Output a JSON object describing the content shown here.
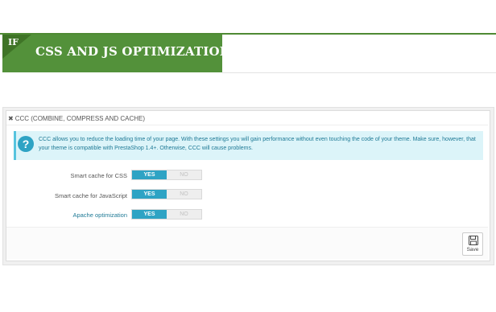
{
  "banner": {
    "badge": "IF",
    "title": "CSS AND JS OPTIMIZATION"
  },
  "panel": {
    "heading": "CCC (COMBINE, COMPRESS AND CACHE)",
    "heading_icon": "cogs-icon",
    "alert": {
      "icon": "question-circle-icon",
      "text_line1": "CCC allows you to reduce the loading time of your page. With these settings you will gain performance without even touching the code of your theme. Make sure, however, that",
      "text_line2": "your theme is compatible with PrestaShop 1.4+. Otherwise, CCC will cause problems."
    },
    "rows": [
      {
        "label": "Smart cache for CSS",
        "yes": "YES",
        "no": "NO",
        "value": "YES"
      },
      {
        "label": "Smart cache for JavaScript",
        "yes": "YES",
        "no": "NO",
        "value": "YES"
      },
      {
        "label": "Apache optimization",
        "yes": "YES",
        "no": "NO",
        "value": "YES"
      }
    ],
    "save_label": "Save",
    "save_icon": "floppy-disk-icon"
  },
  "colors": {
    "banner_green": "#53913a",
    "switch_on": "#2ea3c4",
    "alert_bg": "#dcf4f9"
  }
}
